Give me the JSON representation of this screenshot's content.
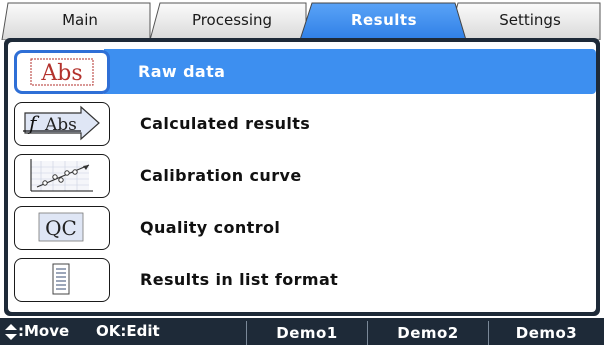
{
  "tabs": [
    {
      "label": "Main",
      "active": false
    },
    {
      "label": "Processing",
      "active": false
    },
    {
      "label": "Results",
      "active": true
    },
    {
      "label": "Settings",
      "active": false
    }
  ],
  "menu": {
    "items": [
      {
        "label": "Raw data",
        "icon": "abs-icon",
        "icon_text": "Abs",
        "selected": true
      },
      {
        "label": "Calculated results",
        "icon": "function-abs-icon",
        "icon_text": "f Abs",
        "selected": false
      },
      {
        "label": "Calibration curve",
        "icon": "calibration-plot-icon",
        "selected": false
      },
      {
        "label": "Quality control",
        "icon": "qc-icon",
        "icon_text": "QC",
        "selected": false
      },
      {
        "label": "Results in list format",
        "icon": "list-document-icon",
        "selected": false
      }
    ]
  },
  "bottom": {
    "move_hint": ":Move",
    "ok_hint": "OK:Edit",
    "softkeys": [
      "Demo1",
      "Demo2",
      "Demo3"
    ]
  },
  "colors": {
    "active_tab": "#3d8ff0",
    "selection": "#3d8ff0",
    "frame": "#1e2a38"
  }
}
